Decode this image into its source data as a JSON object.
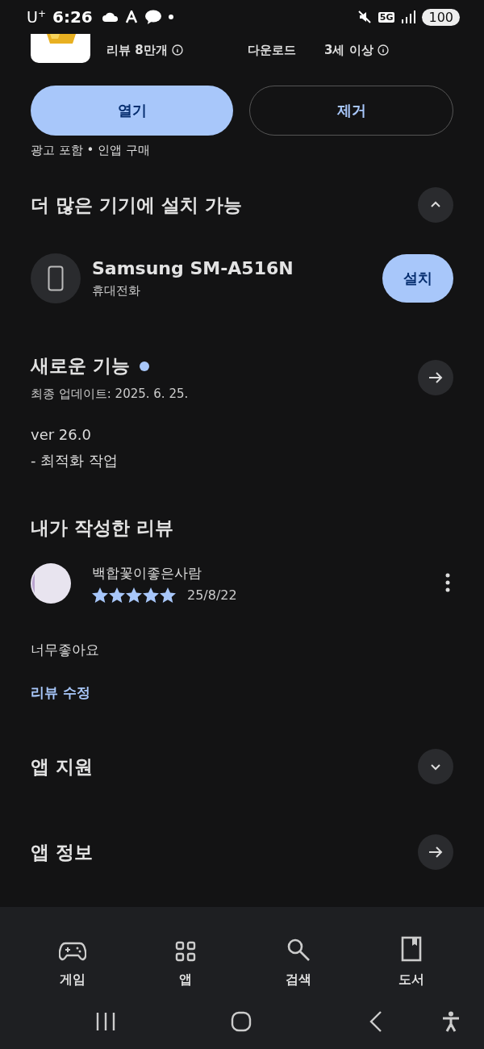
{
  "status_bar": {
    "carrier": "U",
    "carrier_mark": "+",
    "time": "6:26",
    "network": "5G",
    "battery": "100"
  },
  "app_stats": [
    {
      "label": "리뷰 8만개",
      "info": true
    },
    {
      "label": "다운로드",
      "info": false
    },
    {
      "label": "3세 이상",
      "info": true
    }
  ],
  "actions": [
    {
      "label": "열기",
      "kind": "primary"
    },
    {
      "label": "제거",
      "kind": "outline"
    }
  ],
  "note": "광고 포함 • 인앱 구매",
  "devices_section": {
    "title": "더 많은 기기에 설치 가능",
    "expanded": true,
    "device": {
      "name": "Samsung SM-A516N",
      "type": "휴대전화",
      "button": "설치"
    }
  },
  "whats_new": {
    "title": "새로운 기능",
    "new": true,
    "updated": "최종 업데이트: 2025. 6. 25.",
    "lines": [
      "ver 26.0",
      "- 최적화 작업"
    ]
  },
  "my_review": {
    "title": "내가 작성한 리뷰",
    "author": "백합꽃이좋은사람",
    "stars": 5,
    "date": "25/8/22",
    "text": "너무좋아요",
    "edit_link": "리뷰 수정"
  },
  "sections": [
    {
      "title": "앱 지원",
      "kind": "expand"
    },
    {
      "title": "앱 정보",
      "kind": "arrow"
    }
  ],
  "bottom_nav": [
    {
      "label": "게임",
      "kind": "games"
    },
    {
      "label": "앱",
      "kind": "apps"
    },
    {
      "label": "검색",
      "kind": "search"
    },
    {
      "label": "도서",
      "kind": "books"
    }
  ]
}
